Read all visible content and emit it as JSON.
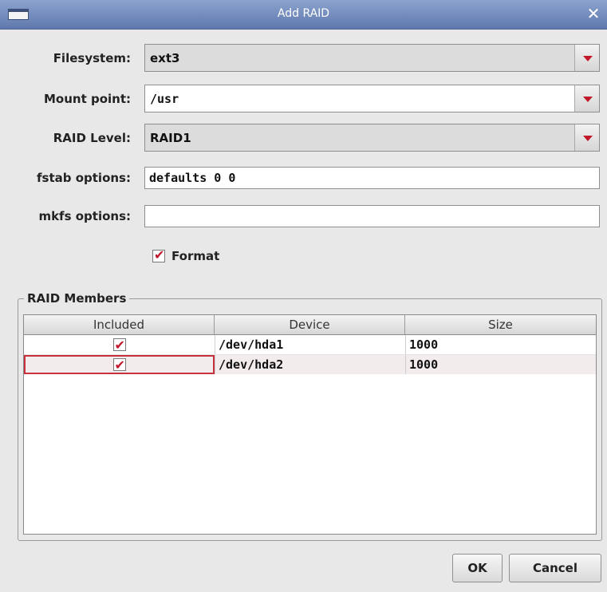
{
  "window": {
    "title": "Add RAID",
    "close_glyph": "✕"
  },
  "form": {
    "filesystem": {
      "label": "Filesystem:",
      "value": "ext3"
    },
    "mount_point": {
      "label": "Mount point:",
      "value": "/usr"
    },
    "raid_level": {
      "label": "RAID Level:",
      "value": "RAID1"
    },
    "fstab_options": {
      "label": "fstab options:",
      "value": "defaults 0 0"
    },
    "mkfs_options": {
      "label": "mkfs options:",
      "value": ""
    },
    "format": {
      "label": "Format",
      "checked": true
    }
  },
  "raid_members": {
    "title": "RAID Members",
    "columns": [
      "Included",
      "Device",
      "Size"
    ],
    "rows": [
      {
        "included": true,
        "device": "/dev/hda1",
        "size": "1000"
      },
      {
        "included": true,
        "device": "/dev/hda2",
        "size": "1000"
      }
    ],
    "check_glyph": "✔"
  },
  "buttons": {
    "ok": "OK",
    "cancel": "Cancel"
  },
  "icons": {
    "dropdown": "chevron-down-icon",
    "close": "close-icon"
  },
  "colors": {
    "accent": "#c0182a",
    "titlebar": "#6f88bc"
  }
}
